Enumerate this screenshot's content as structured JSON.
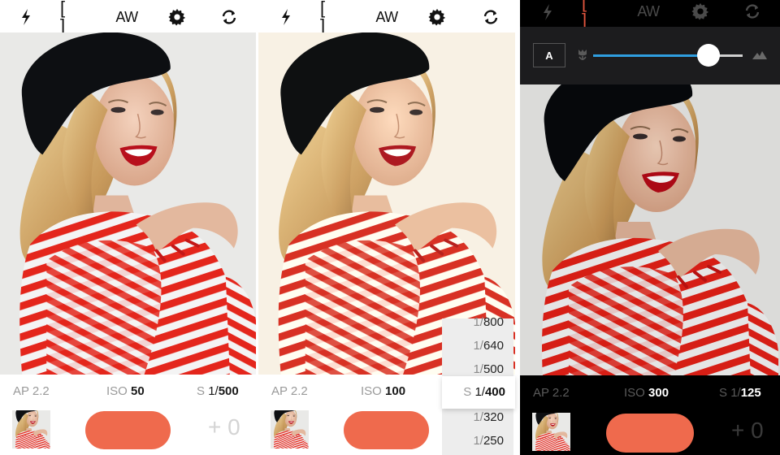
{
  "colors": {
    "accent_shutter": "#ef6a4d",
    "slider_fill": "#2f9ee0",
    "focus_active": "#e2553e",
    "dark_bg": "#000000",
    "focus_panel_bg": "#1c1c1e"
  },
  "panels": [
    {
      "theme": "light",
      "toolbar": {
        "flash_icon": "flash-icon",
        "focus_label": "[ ]",
        "white_balance_label": "AW",
        "settings_icon": "gear-icon",
        "switch_camera_icon": "rotate-camera-icon"
      },
      "exposure": {
        "aperture_label": "AP",
        "aperture_value": "2.2",
        "iso_label": "ISO",
        "iso_value": "50",
        "shutter_label": "S",
        "shutter_prefix": "1/",
        "shutter_value": "500"
      },
      "ev_label": "+0"
    },
    {
      "theme": "light",
      "toolbar": {
        "flash_icon": "flash-icon",
        "focus_label": "[ ]",
        "white_balance_label": "AW",
        "settings_icon": "gear-icon",
        "switch_camera_icon": "rotate-camera-icon"
      },
      "exposure": {
        "aperture_label": "AP",
        "aperture_value": "2.2",
        "iso_label": "ISO",
        "iso_value": "100",
        "shutter_label": "S",
        "shutter_prefix": "1/",
        "shutter_value": "400"
      },
      "shutter_picker": {
        "options_above": [
          "800",
          "640",
          "500"
        ],
        "selected": "400",
        "options_below": [
          "320",
          "250"
        ],
        "prefix": "1/"
      }
    },
    {
      "theme": "dark",
      "toolbar": {
        "flash_icon": "flash-icon",
        "focus_label": "[ ]",
        "white_balance_label": "AW",
        "settings_icon": "gear-icon",
        "switch_camera_icon": "rotate-camera-icon",
        "focus_active": true
      },
      "focus_panel": {
        "auto_label": "A",
        "near_icon": "macro-flower-icon",
        "far_icon": "mountain-icon",
        "slider_value_percent": 77
      },
      "exposure": {
        "aperture_label": "AP",
        "aperture_value": "2.2",
        "iso_label": "ISO",
        "iso_value": "300",
        "shutter_label": "S",
        "shutter_prefix": "1/",
        "shutter_value": "125"
      },
      "ev_label": "+0"
    }
  ]
}
